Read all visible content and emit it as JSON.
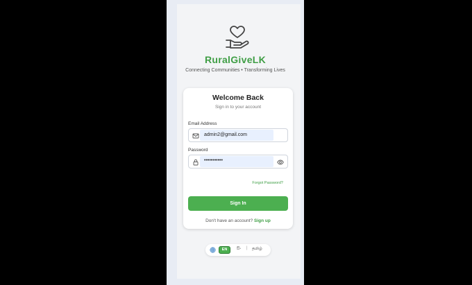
{
  "app": {
    "brand": "RuralGiveLK",
    "tagline": "Connecting Communities • Transforming Lives",
    "logo_icon": "heart-in-hand-icon"
  },
  "login_card": {
    "title": "Welcome Back",
    "subtitle": "Sign in to your account",
    "email": {
      "label": "Email Address",
      "value": "admin2@gmail.com"
    },
    "password": {
      "label": "Password",
      "value": "•••••••••••"
    },
    "forgot_label": "Forgot Password?",
    "signin_label": "Sign In",
    "signup_prompt": "Don't have an account?",
    "signup_link": "Sign up"
  },
  "language": {
    "selected": "EN",
    "sinhala": "සිං",
    "separator": "|",
    "tamil": "தமிழ்"
  },
  "colors": {
    "accent": "#4caf50",
    "brand_text": "#3f9e45",
    "autofill_bg": "#e8f0fe"
  }
}
